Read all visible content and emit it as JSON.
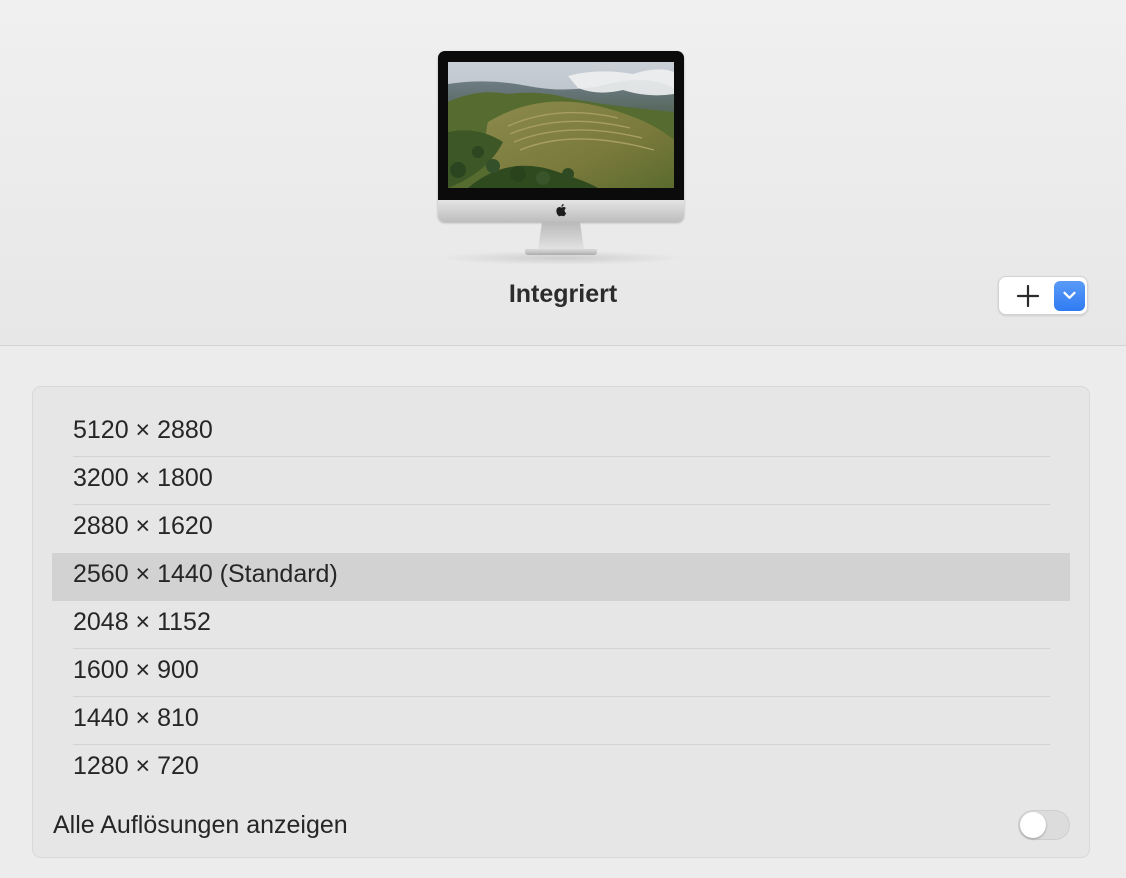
{
  "display": {
    "name": "Integriert",
    "icon": "imac-icon"
  },
  "controls": {
    "add_icon": "plus-icon",
    "dropdown_icon": "chevron-down-icon",
    "accent_color": "#3b82f6"
  },
  "resolutions": {
    "items": [
      {
        "label": "5120 × 2880",
        "selected": false
      },
      {
        "label": "3200 × 1800",
        "selected": false
      },
      {
        "label": "2880 × 1620",
        "selected": false
      },
      {
        "label": "2560 × 1440 (Standard)",
        "selected": true
      },
      {
        "label": "2048 × 1152",
        "selected": false
      },
      {
        "label": "1600 × 900",
        "selected": false
      },
      {
        "label": "1440 × 810",
        "selected": false
      },
      {
        "label": "1280 × 720",
        "selected": false
      }
    ],
    "selected_color": "#d2d2d2"
  },
  "show_all": {
    "label": "Alle Auflösungen anzeigen",
    "enabled": false
  }
}
